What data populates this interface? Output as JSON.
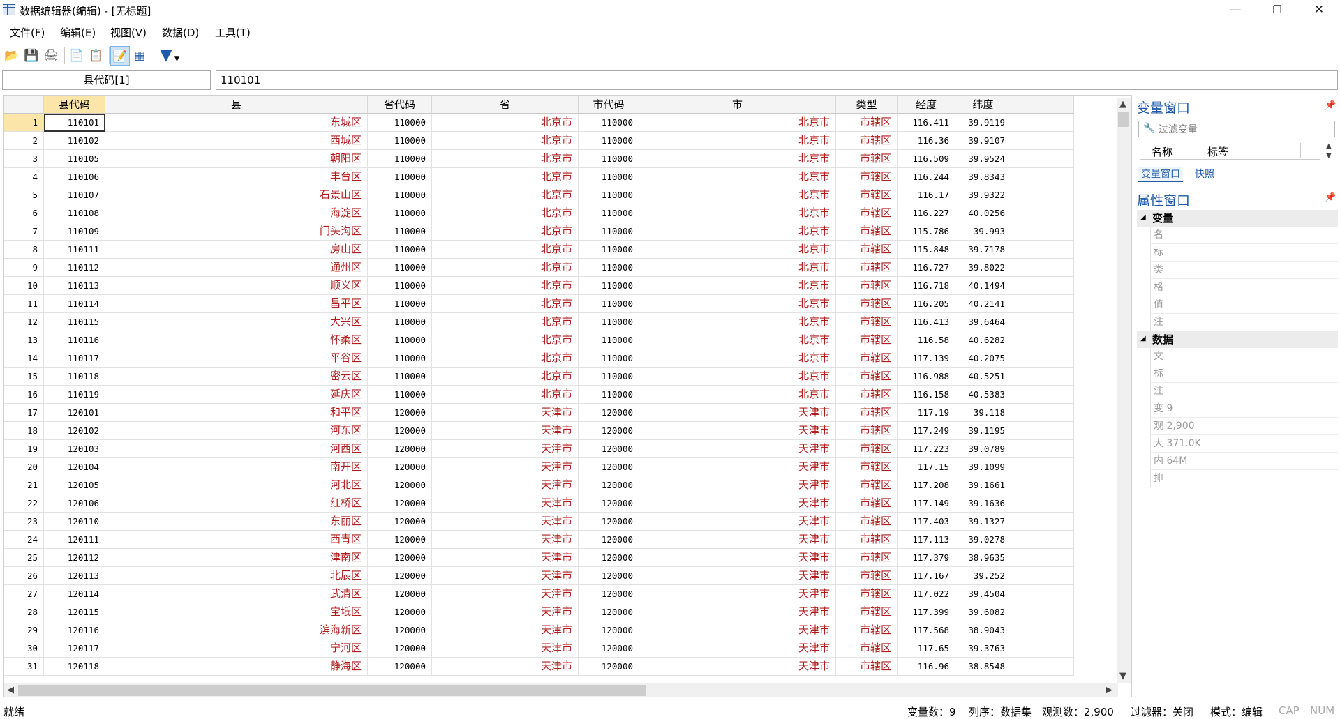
{
  "window": {
    "title": "数据编辑器(编辑) - [无标题]",
    "minimize": "—",
    "maximize": "❐",
    "close": "✕"
  },
  "menu": [
    "文件(F)",
    "编辑(E)",
    "视图(V)",
    "数据(D)",
    "工具(T)"
  ],
  "toolbar": {
    "icons": [
      "open-folder-icon",
      "save-icon",
      "print-icon",
      "copy-icon",
      "paste-icon",
      "edit-mode-icon",
      "browse-mode-icon",
      "filter-icon"
    ],
    "glyphs": [
      "📂",
      "💾",
      "🖨",
      "📄",
      "📋",
      "📝",
      "▦",
      "▼"
    ]
  },
  "cell_ref": {
    "name": "县代码[1]",
    "value": "110101"
  },
  "grid": {
    "columns": [
      "县代码",
      "县",
      "省代码",
      "省",
      "市代码",
      "市",
      "类型",
      "经度",
      "纬度"
    ],
    "rows": [
      [
        "110101",
        "东城区",
        "110000",
        "北京市",
        "110000",
        "北京市",
        "市辖区",
        "116.411",
        "39.9119"
      ],
      [
        "110102",
        "西城区",
        "110000",
        "北京市",
        "110000",
        "北京市",
        "市辖区",
        "116.36",
        "39.9107"
      ],
      [
        "110105",
        "朝阳区",
        "110000",
        "北京市",
        "110000",
        "北京市",
        "市辖区",
        "116.509",
        "39.9524"
      ],
      [
        "110106",
        "丰台区",
        "110000",
        "北京市",
        "110000",
        "北京市",
        "市辖区",
        "116.244",
        "39.8343"
      ],
      [
        "110107",
        "石景山区",
        "110000",
        "北京市",
        "110000",
        "北京市",
        "市辖区",
        "116.17",
        "39.9322"
      ],
      [
        "110108",
        "海淀区",
        "110000",
        "北京市",
        "110000",
        "北京市",
        "市辖区",
        "116.227",
        "40.0256"
      ],
      [
        "110109",
        "门头沟区",
        "110000",
        "北京市",
        "110000",
        "北京市",
        "市辖区",
        "115.786",
        "39.993"
      ],
      [
        "110111",
        "房山区",
        "110000",
        "北京市",
        "110000",
        "北京市",
        "市辖区",
        "115.848",
        "39.7178"
      ],
      [
        "110112",
        "通州区",
        "110000",
        "北京市",
        "110000",
        "北京市",
        "市辖区",
        "116.727",
        "39.8022"
      ],
      [
        "110113",
        "顺义区",
        "110000",
        "北京市",
        "110000",
        "北京市",
        "市辖区",
        "116.718",
        "40.1494"
      ],
      [
        "110114",
        "昌平区",
        "110000",
        "北京市",
        "110000",
        "北京市",
        "市辖区",
        "116.205",
        "40.2141"
      ],
      [
        "110115",
        "大兴区",
        "110000",
        "北京市",
        "110000",
        "北京市",
        "市辖区",
        "116.413",
        "39.6464"
      ],
      [
        "110116",
        "怀柔区",
        "110000",
        "北京市",
        "110000",
        "北京市",
        "市辖区",
        "116.58",
        "40.6282"
      ],
      [
        "110117",
        "平谷区",
        "110000",
        "北京市",
        "110000",
        "北京市",
        "市辖区",
        "117.139",
        "40.2075"
      ],
      [
        "110118",
        "密云区",
        "110000",
        "北京市",
        "110000",
        "北京市",
        "市辖区",
        "116.988",
        "40.5251"
      ],
      [
        "110119",
        "延庆区",
        "110000",
        "北京市",
        "110000",
        "北京市",
        "市辖区",
        "116.158",
        "40.5383"
      ],
      [
        "120101",
        "和平区",
        "120000",
        "天津市",
        "120000",
        "天津市",
        "市辖区",
        "117.19",
        "39.118"
      ],
      [
        "120102",
        "河东区",
        "120000",
        "天津市",
        "120000",
        "天津市",
        "市辖区",
        "117.249",
        "39.1195"
      ],
      [
        "120103",
        "河西区",
        "120000",
        "天津市",
        "120000",
        "天津市",
        "市辖区",
        "117.223",
        "39.0789"
      ],
      [
        "120104",
        "南开区",
        "120000",
        "天津市",
        "120000",
        "天津市",
        "市辖区",
        "117.15",
        "39.1099"
      ],
      [
        "120105",
        "河北区",
        "120000",
        "天津市",
        "120000",
        "天津市",
        "市辖区",
        "117.208",
        "39.1661"
      ],
      [
        "120106",
        "红桥区",
        "120000",
        "天津市",
        "120000",
        "天津市",
        "市辖区",
        "117.149",
        "39.1636"
      ],
      [
        "120110",
        "东丽区",
        "120000",
        "天津市",
        "120000",
        "天津市",
        "市辖区",
        "117.403",
        "39.1327"
      ],
      [
        "120111",
        "西青区",
        "120000",
        "天津市",
        "120000",
        "天津市",
        "市辖区",
        "117.113",
        "39.0278"
      ],
      [
        "120112",
        "津南区",
        "120000",
        "天津市",
        "120000",
        "天津市",
        "市辖区",
        "117.379",
        "38.9635"
      ],
      [
        "120113",
        "北辰区",
        "120000",
        "天津市",
        "120000",
        "天津市",
        "市辖区",
        "117.167",
        "39.252"
      ],
      [
        "120114",
        "武清区",
        "120000",
        "天津市",
        "120000",
        "天津市",
        "市辖区",
        "117.022",
        "39.4504"
      ],
      [
        "120115",
        "宝坻区",
        "120000",
        "天津市",
        "120000",
        "天津市",
        "市辖区",
        "117.399",
        "39.6082"
      ],
      [
        "120116",
        "滨海新区",
        "120000",
        "天津市",
        "120000",
        "天津市",
        "市辖区",
        "117.568",
        "38.9043"
      ],
      [
        "120117",
        "宁河区",
        "120000",
        "天津市",
        "120000",
        "天津市",
        "市辖区",
        "117.65",
        "39.3763"
      ],
      [
        "120118",
        "静海区",
        "120000",
        "天津市",
        "120000",
        "天津市",
        "市辖区",
        "116.96",
        "38.8548"
      ]
    ]
  },
  "right_panel": {
    "variables_title": "变量窗口",
    "filter_placeholder": "过滤变量",
    "col_name": "名称",
    "col_label": "标签",
    "tab_variables": "变量窗口",
    "tab_snapshots": "快照",
    "properties_title": "属性窗口",
    "section_variables": "变量",
    "variable_rows": [
      "名",
      "标",
      "类",
      "格",
      "值",
      "注"
    ],
    "section_data": "数据",
    "data_rows": [
      "文",
      "标",
      "注",
      "变 9",
      "观 2,900",
      "大 371.0K",
      "内 64M",
      "排"
    ]
  },
  "status": {
    "ready": "就绪",
    "vars": "变量数：9",
    "order": "列序：数据集",
    "obs": "观测数：2,900",
    "filter": "过滤器：关闭",
    "mode": "模式：编辑",
    "cap": "CAP",
    "num": "NUM"
  }
}
